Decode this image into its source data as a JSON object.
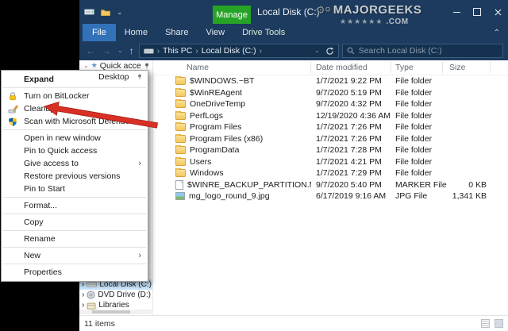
{
  "colors": {
    "titlebar_bg": "#1d3b5e",
    "manage_green": "#27a427",
    "file_tab_blue": "#3272b8",
    "nav_selection_blue": "#cce8ff",
    "arrow_red": "#d93025",
    "folder_yellow": "#f3c75f",
    "menu_bg": "#ffffff",
    "desktop_bg": "#000000"
  },
  "icons": {
    "back_arrow": "←",
    "forward_arrow": "→",
    "up_arrow": "↑",
    "small_caret": "⌄",
    "ribbon_collapse": "⌃",
    "breadcrumb_chevron": "›",
    "submenu_arrow": "›",
    "nav_expand_chevron": "›",
    "nav_collapse_chevron": "⌄",
    "quick_access_star": "★",
    "gear": "⚙"
  },
  "titlebar": {
    "title": "Local Disk (C:)",
    "manage_label": "Manage"
  },
  "watermark": {
    "name": "MAJORGEEKS",
    "domain": ".COM",
    "stars": "★★★★★★"
  },
  "ribbon": {
    "file_tab": "File",
    "tabs": [
      {
        "label": "Home"
      },
      {
        "label": "Share"
      },
      {
        "label": "View"
      },
      {
        "label": "Drive Tools"
      }
    ]
  },
  "address_bar": {
    "crumb_root": "This PC",
    "crumb_current": "Local Disk (C:)",
    "search_placeholder": "Search Local Disk (C:)"
  },
  "nav_pane": {
    "quick_access": "Quick access",
    "desktop": "Desktop",
    "local_disk": "Local Disk (C:)",
    "dvd_drive": "DVD Drive (D:)",
    "libraries": "Libraries"
  },
  "context_menu": {
    "items": [
      {
        "label": "Expand"
      },
      {
        "label": "Turn on BitLocker"
      },
      {
        "label": "Cleanup"
      },
      {
        "label": "Scan with Microsoft Defender..."
      },
      {
        "label": "Open in new window"
      },
      {
        "label": "Pin to Quick access"
      },
      {
        "label": "Give access to"
      },
      {
        "label": "Restore previous versions"
      },
      {
        "label": "Pin to Start"
      },
      {
        "label": "Format..."
      },
      {
        "label": "Copy"
      },
      {
        "label": "Rename"
      },
      {
        "label": "New"
      },
      {
        "label": "Properties"
      }
    ]
  },
  "file_list": {
    "columns": {
      "name": "Name",
      "date": "Date modified",
      "type": "Type",
      "size": "Size"
    },
    "rows": [
      {
        "name": "$WINDOWS.~BT",
        "date": "1/7/2021 9:22 PM",
        "type": "File folder",
        "size": ""
      },
      {
        "name": "$WinREAgent",
        "date": "9/7/2020 5:19 PM",
        "type": "File folder",
        "size": ""
      },
      {
        "name": "OneDriveTemp",
        "date": "9/7/2020 4:32 PM",
        "type": "File folder",
        "size": ""
      },
      {
        "name": "PerfLogs",
        "date": "12/19/2020 4:36 AM",
        "type": "File folder",
        "size": ""
      },
      {
        "name": "Program Files",
        "date": "1/7/2021 7:26 PM",
        "type": "File folder",
        "size": ""
      },
      {
        "name": "Program Files (x86)",
        "date": "1/7/2021 7:26 PM",
        "type": "File folder",
        "size": ""
      },
      {
        "name": "ProgramData",
        "date": "1/7/2021 7:28 PM",
        "type": "File folder",
        "size": ""
      },
      {
        "name": "Users",
        "date": "1/7/2021 4:21 PM",
        "type": "File folder",
        "size": ""
      },
      {
        "name": "Windows",
        "date": "1/7/2021 7:29 PM",
        "type": "File folder",
        "size": ""
      },
      {
        "name": "$WINRE_BACKUP_PARTITION.MARKER",
        "date": "9/7/2020 5:40 PM",
        "type": "MARKER File",
        "size": "0 KB"
      },
      {
        "name": "mg_logo_round_9.jpg",
        "date": "6/17/2019 9:16 AM",
        "type": "JPG File",
        "size": "1,341 KB"
      }
    ]
  },
  "status_bar": {
    "items_count": "11 items"
  }
}
